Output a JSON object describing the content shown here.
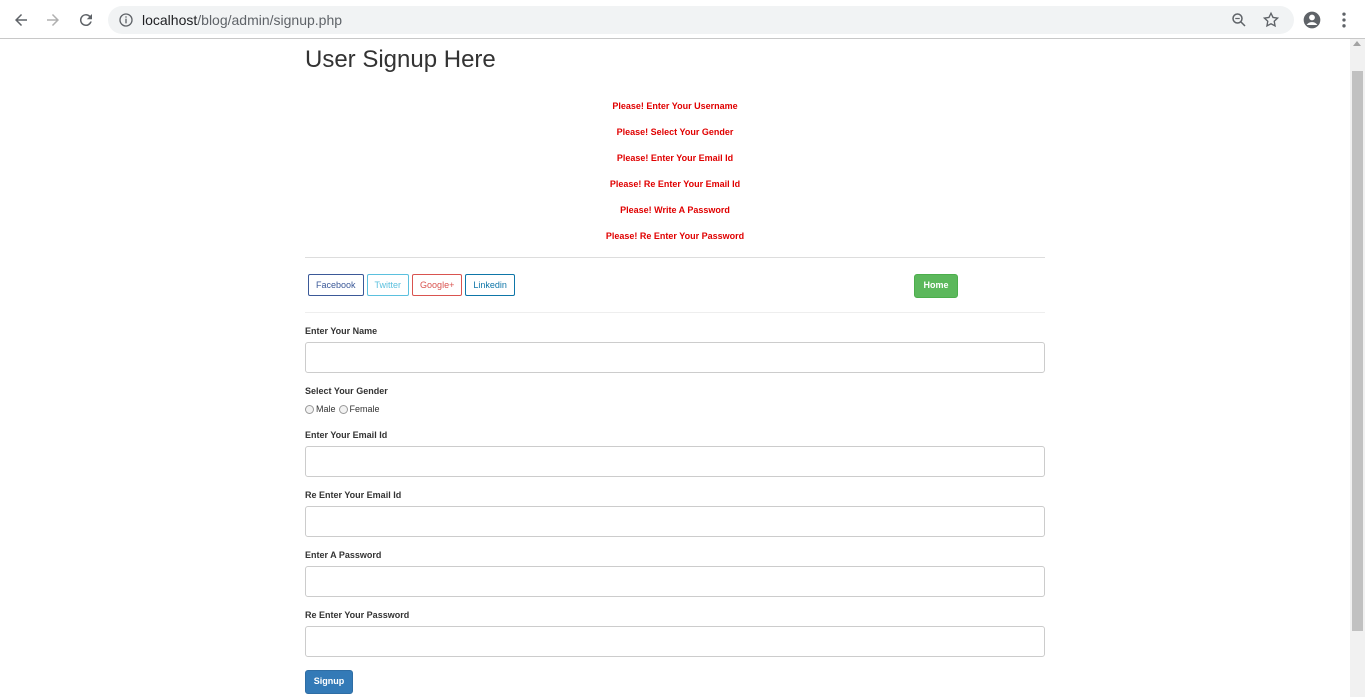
{
  "browser": {
    "url_host": "localhost",
    "url_path": "/blog/admin/signup.php"
  },
  "page": {
    "title": "User Signup Here",
    "errors": [
      "Please! Enter Your Username",
      "Please! Select Your Gender",
      "Please! Enter Your Email Id",
      "Please! Re Enter Your Email Id",
      "Please! Write A Password",
      "Please! Re Enter Your Password"
    ],
    "social": {
      "facebook": "Facebook",
      "twitter": "Twitter",
      "googleplus": "Google+",
      "linkedin": "Linkedin"
    },
    "home_label": "Home",
    "form": {
      "name_label": "Enter Your Name",
      "name_value": "",
      "gender_label": "Select Your Gender",
      "gender_male": "Male",
      "gender_female": "Female",
      "email_label": "Enter Your Email Id",
      "email_value": "",
      "reemail_label": "Re Enter Your Email Id",
      "reemail_value": "",
      "password_label": "Enter A Password",
      "password_value": "",
      "repassword_label": "Re Enter Your Password",
      "repassword_value": "",
      "submit_label": "Signup"
    }
  },
  "colors": {
    "error": "#e00000",
    "home_button": "#5cb85c",
    "signup_button": "#337ab7"
  }
}
